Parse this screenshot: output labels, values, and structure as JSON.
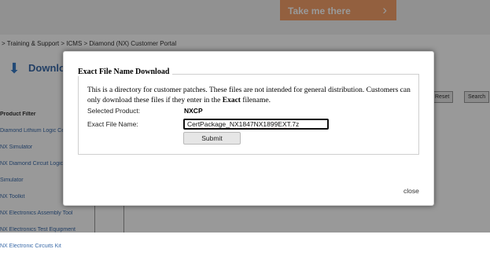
{
  "background": {
    "promo_button": "Take me there",
    "breadcrumb": "> Training & Support > ICMS > Diamond (NX) Customer Portal",
    "page_heading": "Download",
    "sidebar_items": [
      "Product Filter",
      "Diamond Lithium Logic Cell",
      "NX Simulator",
      "NX Diamond Circuit Logic Cell",
      "Simulator",
      "NX Toolkit",
      "NX Electronics Assembly Tool",
      "NX Electronics Test Equipment",
      "NX Electronic Circuits Kit"
    ],
    "right_buttons": [
      "Reset",
      "Search"
    ]
  },
  "modal": {
    "legend": "Exact File Name Download",
    "description_prefix": "This is a directory for customer patches. These files are not intended for general distribution. Customers can only download these files if they enter in the ",
    "description_bold": "Exact",
    "description_suffix": " filename.",
    "selected_product_label": "Selected Product:",
    "selected_product_value": "NXCP",
    "filename_label": "Exact File Name:",
    "filename_value": "CertPackage_NX1847NX1899EXT.7z",
    "submit_label": "Submit",
    "close_label": "close"
  }
}
